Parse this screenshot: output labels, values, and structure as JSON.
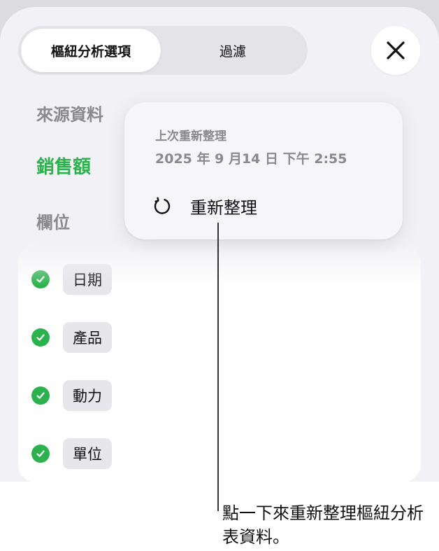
{
  "tabs": {
    "pivot_options": "樞紐分析選項",
    "filter": "過濾"
  },
  "close_icon": "close-icon",
  "source": {
    "label": "來源資料",
    "value": "銷售額"
  },
  "fields": {
    "label": "欄位",
    "items": [
      "日期",
      "產品",
      "動力",
      "單位"
    ]
  },
  "popover": {
    "last_refresh_label": "上次重新整理",
    "last_refresh_time": "2025 年 9 月14 日 下午 2:55",
    "refresh_label": "重新整理",
    "refresh_icon": "refresh-icon"
  },
  "callout": {
    "text": "點一下來重新整理樞紐分析表資料。"
  },
  "colors": {
    "accent_green": "#2bb24c",
    "sheet_bg": "#f2f2f6",
    "backdrop": "#dcdce0"
  }
}
